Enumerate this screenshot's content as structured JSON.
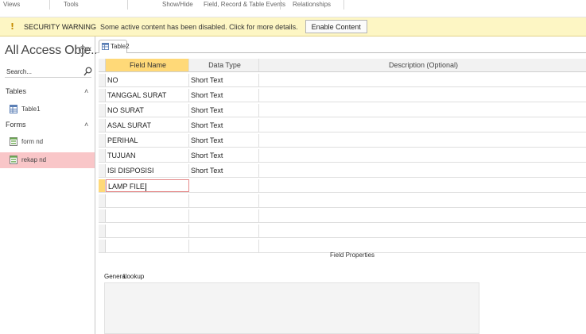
{
  "ribbon": {
    "groups": [
      "Views",
      "Tools",
      "Show/Hide",
      "Field, Record & Table Events",
      "Relationships"
    ]
  },
  "security_bar": {
    "icon": "warning-icon",
    "title": "SECURITY WARNING",
    "message": "Some active content has been disabled. Click for more details.",
    "button_label": "Enable Content",
    "background": "#fdf6c4"
  },
  "nav": {
    "title": "All Access Obje...",
    "search_placeholder": "Search...",
    "groups": [
      {
        "label": "Tables",
        "items": [
          {
            "label": "Table1",
            "icon": "table-icon"
          }
        ]
      },
      {
        "label": "Forms",
        "items": [
          {
            "label": "form nd",
            "icon": "form-icon"
          },
          {
            "label": "rekap nd",
            "icon": "form-icon",
            "selected": true
          }
        ]
      }
    ],
    "selected_color": "#f9c6c8"
  },
  "document": {
    "tab_label": "Table2",
    "columns": [
      "Field Name",
      "Data Type",
      "Description (Optional)"
    ],
    "rows": [
      {
        "field": "NO",
        "type": "Short Text",
        "description": ""
      },
      {
        "field": "TANGGAL SURAT",
        "type": "Short Text",
        "description": ""
      },
      {
        "field": "NO SURAT",
        "type": "Short Text",
        "description": ""
      },
      {
        "field": "ASAL SURAT",
        "type": "Short Text",
        "description": ""
      },
      {
        "field": "PERIHAL",
        "type": "Short Text",
        "description": ""
      },
      {
        "field": "TUJUAN",
        "type": "Short Text",
        "description": ""
      },
      {
        "field": "ISI DISPOSISI",
        "type": "Short Text",
        "description": ""
      },
      {
        "field": "LAMP FILE",
        "type": "",
        "description": ""
      },
      {
        "field": "",
        "type": "",
        "description": ""
      },
      {
        "field": "",
        "type": "",
        "description": ""
      },
      {
        "field": "",
        "type": "",
        "description": ""
      },
      {
        "field": "",
        "type": "",
        "description": ""
      }
    ],
    "header_highlight": "#ffd978"
  },
  "field_properties": {
    "label": "Field Properties",
    "tabs": [
      "General",
      "Lookup"
    ]
  }
}
